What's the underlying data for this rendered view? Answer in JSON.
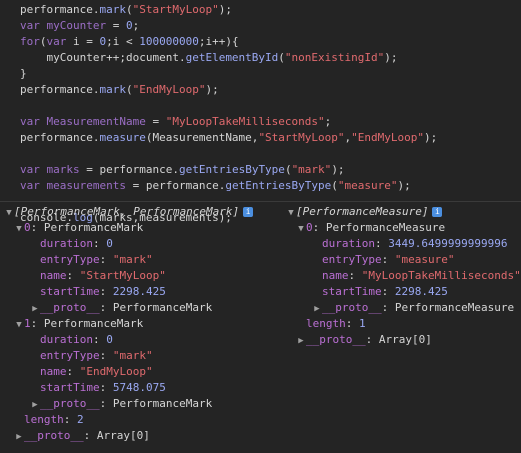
{
  "code": {
    "lines": [
      {
        "tokens": [
          {
            "t": "performance.",
            "c": "id"
          },
          {
            "t": "mark",
            "c": "meth"
          },
          {
            "t": "(",
            "c": "id"
          },
          {
            "t": "\"StartMyLoop\"",
            "c": "str"
          },
          {
            "t": ");",
            "c": "id"
          }
        ]
      },
      {
        "tokens": [
          {
            "t": "var ",
            "c": "kw"
          },
          {
            "t": "myCounter",
            "c": "var"
          },
          {
            "t": " = ",
            "c": "id"
          },
          {
            "t": "0",
            "c": "num"
          },
          {
            "t": ";",
            "c": "id"
          }
        ]
      },
      {
        "tokens": [
          {
            "t": "for",
            "c": "kw"
          },
          {
            "t": "(",
            "c": "id"
          },
          {
            "t": "var ",
            "c": "kw"
          },
          {
            "t": "i = ",
            "c": "id"
          },
          {
            "t": "0",
            "c": "num"
          },
          {
            "t": ";i < ",
            "c": "id"
          },
          {
            "t": "100000000",
            "c": "num"
          },
          {
            "t": ";i++){",
            "c": "id"
          }
        ]
      },
      {
        "tokens": [
          {
            "t": "    myCounter++;document.",
            "c": "id"
          },
          {
            "t": "getElementById",
            "c": "meth"
          },
          {
            "t": "(",
            "c": "id"
          },
          {
            "t": "\"nonExistingId\"",
            "c": "str"
          },
          {
            "t": ");",
            "c": "id"
          }
        ]
      },
      {
        "tokens": [
          {
            "t": "}",
            "c": "id"
          }
        ]
      },
      {
        "tokens": [
          {
            "t": "performance.",
            "c": "id"
          },
          {
            "t": "mark",
            "c": "meth"
          },
          {
            "t": "(",
            "c": "id"
          },
          {
            "t": "\"EndMyLoop\"",
            "c": "str"
          },
          {
            "t": ");",
            "c": "id"
          }
        ]
      },
      {
        "tokens": []
      },
      {
        "tokens": [
          {
            "t": "var ",
            "c": "kw"
          },
          {
            "t": "MeasurementName",
            "c": "var"
          },
          {
            "t": " = ",
            "c": "id"
          },
          {
            "t": "\"MyLoopTakeMilliseconds\"",
            "c": "str"
          },
          {
            "t": ";",
            "c": "id"
          }
        ]
      },
      {
        "tokens": [
          {
            "t": "performance.",
            "c": "id"
          },
          {
            "t": "measure",
            "c": "meth"
          },
          {
            "t": "(MeasurementName,",
            "c": "id"
          },
          {
            "t": "\"StartMyLoop\"",
            "c": "str"
          },
          {
            "t": ",",
            "c": "id"
          },
          {
            "t": "\"EndMyLoop\"",
            "c": "str"
          },
          {
            "t": ");",
            "c": "id"
          }
        ]
      },
      {
        "tokens": []
      },
      {
        "tokens": [
          {
            "t": "var ",
            "c": "kw"
          },
          {
            "t": "marks",
            "c": "var"
          },
          {
            "t": " = performance.",
            "c": "id"
          },
          {
            "t": "getEntriesByType",
            "c": "meth"
          },
          {
            "t": "(",
            "c": "id"
          },
          {
            "t": "\"mark\"",
            "c": "str"
          },
          {
            "t": ");",
            "c": "id"
          }
        ]
      },
      {
        "tokens": [
          {
            "t": "var ",
            "c": "kw"
          },
          {
            "t": "measurements",
            "c": "var"
          },
          {
            "t": " = performance.",
            "c": "id"
          },
          {
            "t": "getEntriesByType",
            "c": "meth"
          },
          {
            "t": "(",
            "c": "id"
          },
          {
            "t": "\"measure\"",
            "c": "str"
          },
          {
            "t": ");",
            "c": "id"
          }
        ]
      },
      {
        "tokens": []
      },
      {
        "tokens": [
          {
            "t": "console.",
            "c": "id"
          },
          {
            "t": "log",
            "c": "meth"
          },
          {
            "t": "(marks,measurements);",
            "c": "id"
          }
        ]
      }
    ]
  },
  "left": [
    {
      "indent": 0,
      "tri": "▼",
      "parts": [
        {
          "t": "[PerformanceMark, PerformanceMark]",
          "c": "hdr"
        }
      ],
      "info": true,
      "name": "marks-array-header"
    },
    {
      "indent": 1,
      "tri": "▼",
      "parts": [
        {
          "t": "0",
          "c": "k"
        },
        {
          "t": ": PerformanceMark",
          "c": "v-plain"
        }
      ],
      "name": "mark-0-node"
    },
    {
      "indent": 2,
      "tri": "",
      "parts": [
        {
          "t": "duration",
          "c": "k"
        },
        {
          "t": ": ",
          "c": "v-plain"
        },
        {
          "t": "0",
          "c": "v-num"
        }
      ],
      "name": "mark-0-duration"
    },
    {
      "indent": 2,
      "tri": "",
      "parts": [
        {
          "t": "entryType",
          "c": "k"
        },
        {
          "t": ": ",
          "c": "v-plain"
        },
        {
          "t": "\"mark\"",
          "c": "v-str"
        }
      ],
      "name": "mark-0-entrytype"
    },
    {
      "indent": 2,
      "tri": "",
      "parts": [
        {
          "t": "name",
          "c": "k"
        },
        {
          "t": ": ",
          "c": "v-plain"
        },
        {
          "t": "\"StartMyLoop\"",
          "c": "v-str"
        }
      ],
      "name": "mark-0-name"
    },
    {
      "indent": 2,
      "tri": "",
      "parts": [
        {
          "t": "startTime",
          "c": "k"
        },
        {
          "t": ": ",
          "c": "v-plain"
        },
        {
          "t": "2298.425",
          "c": "v-num"
        }
      ],
      "name": "mark-0-starttime"
    },
    {
      "indent": 2,
      "tri": "▶",
      "parts": [
        {
          "t": "__proto__",
          "c": "proto"
        },
        {
          "t": ": PerformanceMark",
          "c": "v-plain"
        }
      ],
      "name": "mark-0-proto"
    },
    {
      "indent": 1,
      "tri": "▼",
      "parts": [
        {
          "t": "1",
          "c": "k"
        },
        {
          "t": ": PerformanceMark",
          "c": "v-plain"
        }
      ],
      "name": "mark-1-node"
    },
    {
      "indent": 2,
      "tri": "",
      "parts": [
        {
          "t": "duration",
          "c": "k"
        },
        {
          "t": ": ",
          "c": "v-plain"
        },
        {
          "t": "0",
          "c": "v-num"
        }
      ],
      "name": "mark-1-duration"
    },
    {
      "indent": 2,
      "tri": "",
      "parts": [
        {
          "t": "entryType",
          "c": "k"
        },
        {
          "t": ": ",
          "c": "v-plain"
        },
        {
          "t": "\"mark\"",
          "c": "v-str"
        }
      ],
      "name": "mark-1-entrytype"
    },
    {
      "indent": 2,
      "tri": "",
      "parts": [
        {
          "t": "name",
          "c": "k"
        },
        {
          "t": ": ",
          "c": "v-plain"
        },
        {
          "t": "\"EndMyLoop\"",
          "c": "v-str"
        }
      ],
      "name": "mark-1-name"
    },
    {
      "indent": 2,
      "tri": "",
      "parts": [
        {
          "t": "startTime",
          "c": "k"
        },
        {
          "t": ": ",
          "c": "v-plain"
        },
        {
          "t": "5748.075",
          "c": "v-num"
        }
      ],
      "name": "mark-1-starttime"
    },
    {
      "indent": 2,
      "tri": "▶",
      "parts": [
        {
          "t": "__proto__",
          "c": "proto"
        },
        {
          "t": ": PerformanceMark",
          "c": "v-plain"
        }
      ],
      "name": "mark-1-proto"
    },
    {
      "indent": 1,
      "tri": "",
      "parts": [
        {
          "t": "length",
          "c": "k"
        },
        {
          "t": ": ",
          "c": "v-plain"
        },
        {
          "t": "2",
          "c": "v-num"
        }
      ],
      "name": "marks-length"
    },
    {
      "indent": 1,
      "tri": "▶",
      "parts": [
        {
          "t": "__proto__",
          "c": "proto"
        },
        {
          "t": ": Array[0]",
          "c": "v-plain"
        }
      ],
      "name": "marks-proto"
    }
  ],
  "right": [
    {
      "indent": 0,
      "tri": "▼",
      "parts": [
        {
          "t": "[PerformanceMeasure]",
          "c": "hdr"
        }
      ],
      "info": true,
      "name": "measurements-array-header"
    },
    {
      "indent": 1,
      "tri": "▼",
      "parts": [
        {
          "t": "0",
          "c": "k"
        },
        {
          "t": ": PerformanceMeasure",
          "c": "v-plain"
        }
      ],
      "name": "measure-0-node"
    },
    {
      "indent": 2,
      "tri": "",
      "parts": [
        {
          "t": "duration",
          "c": "k"
        },
        {
          "t": ": ",
          "c": "v-plain"
        },
        {
          "t": "3449.6499999999996",
          "c": "v-num"
        }
      ],
      "name": "measure-0-duration"
    },
    {
      "indent": 2,
      "tri": "",
      "parts": [
        {
          "t": "entryType",
          "c": "k"
        },
        {
          "t": ": ",
          "c": "v-plain"
        },
        {
          "t": "\"measure\"",
          "c": "v-str"
        }
      ],
      "name": "measure-0-entrytype"
    },
    {
      "indent": 2,
      "tri": "",
      "parts": [
        {
          "t": "name",
          "c": "k"
        },
        {
          "t": ": ",
          "c": "v-plain"
        },
        {
          "t": "\"MyLoopTakeMilliseconds\"",
          "c": "v-str"
        }
      ],
      "name": "measure-0-name"
    },
    {
      "indent": 2,
      "tri": "",
      "parts": [
        {
          "t": "startTime",
          "c": "k"
        },
        {
          "t": ": ",
          "c": "v-plain"
        },
        {
          "t": "2298.425",
          "c": "v-num"
        }
      ],
      "name": "measure-0-starttime"
    },
    {
      "indent": 2,
      "tri": "▶",
      "parts": [
        {
          "t": "__proto__",
          "c": "proto"
        },
        {
          "t": ": PerformanceMeasure",
          "c": "v-plain"
        }
      ],
      "name": "measure-0-proto"
    },
    {
      "indent": 1,
      "tri": "",
      "parts": [
        {
          "t": "length",
          "c": "k"
        },
        {
          "t": ": ",
          "c": "v-plain"
        },
        {
          "t": "1",
          "c": "v-num"
        }
      ],
      "name": "measurements-length"
    },
    {
      "indent": 1,
      "tri": "▶",
      "parts": [
        {
          "t": "__proto__",
          "c": "proto"
        },
        {
          "t": ": Array[0]",
          "c": "v-plain"
        }
      ],
      "name": "measurements-proto"
    }
  ],
  "icons": {
    "info": "i",
    "info_icon": "info-icon",
    "expanded": "triangle-down-icon",
    "collapsed": "triangle-right-icon"
  },
  "colors": {
    "background": "#242424",
    "keyword": "#9b6ec6",
    "string": "#e06a6e",
    "number": "#9aa8f2",
    "property": "#ba6fd3",
    "info_badge": "#4b8fe0"
  }
}
